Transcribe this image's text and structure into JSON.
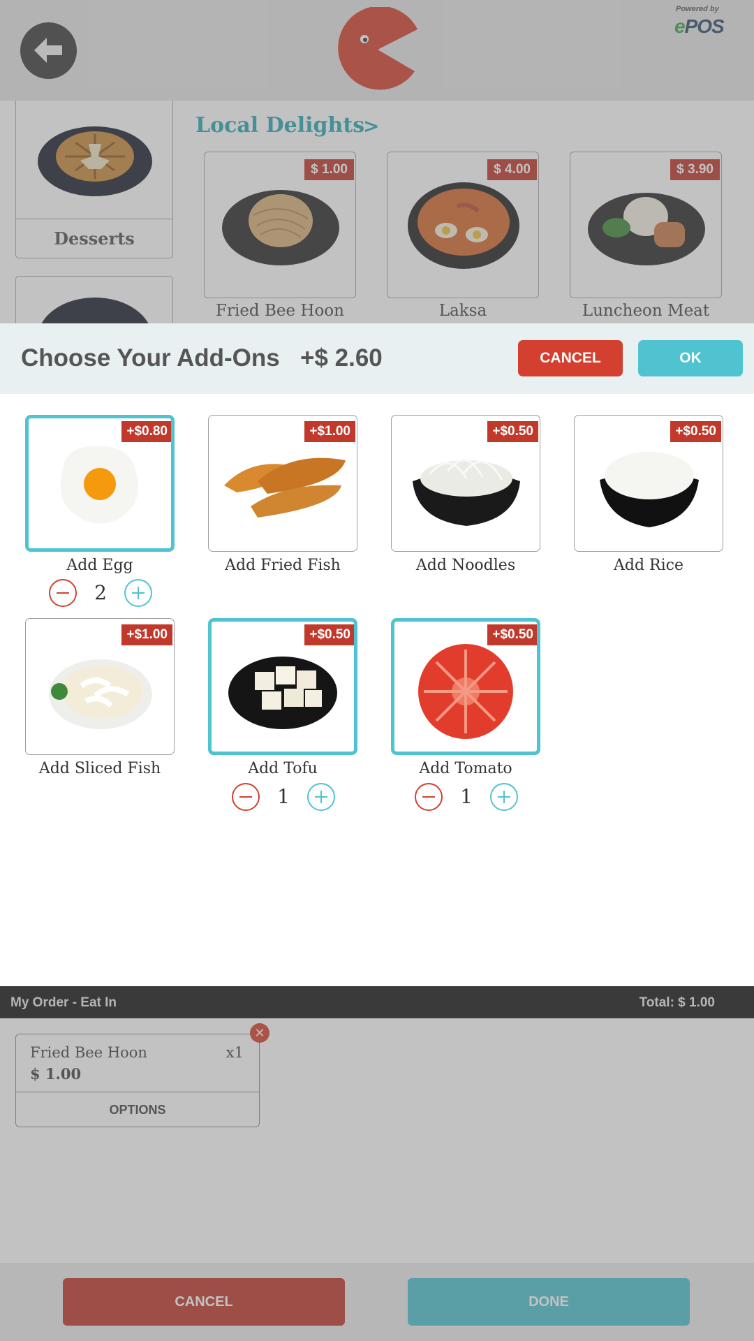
{
  "header": {
    "powered_by": "Powered by",
    "brand_e": "e",
    "brand_pos": "POS"
  },
  "categories": [
    {
      "label": "Desserts"
    }
  ],
  "section": {
    "title": "Local Delights",
    "arrow": ">"
  },
  "products": [
    {
      "name": "Fried Bee Hoon",
      "price": "$ 1.00"
    },
    {
      "name": "Laksa",
      "price": "$ 4.00"
    },
    {
      "name": "Luncheon Meat",
      "price": "$ 3.90"
    }
  ],
  "modal": {
    "title": "Choose Your Add-Ons",
    "total": "+$ 2.60",
    "cancel_label": "CANCEL",
    "ok_label": "OK"
  },
  "addons": [
    {
      "name": "Add Egg",
      "price": "+$0.80",
      "selected": true,
      "qty": "2",
      "icon": "egg-icon"
    },
    {
      "name": "Add Fried Fish",
      "price": "+$1.00",
      "selected": false,
      "icon": "fried-fish-icon"
    },
    {
      "name": "Add Noodles",
      "price": "+$0.50",
      "selected": false,
      "icon": "noodles-icon"
    },
    {
      "name": "Add Rice",
      "price": "+$0.50",
      "selected": false,
      "icon": "rice-icon"
    },
    {
      "name": "Add Sliced Fish",
      "price": "+$1.00",
      "selected": false,
      "icon": "sliced-fish-icon"
    },
    {
      "name": "Add Tofu",
      "price": "+$0.50",
      "selected": true,
      "qty": "1",
      "icon": "tofu-icon"
    },
    {
      "name": "Add Tomato",
      "price": "+$0.50",
      "selected": true,
      "qty": "1",
      "icon": "tomato-icon"
    }
  ],
  "order": {
    "bar_label": "My Order - Eat In",
    "total": "Total: $ 1.00",
    "items": [
      {
        "name": "Fried Bee Hoon",
        "qty": "x1",
        "price": "$ 1.00",
        "options_label": "OPTIONS",
        "remove": "✕"
      }
    ]
  },
  "footer": {
    "cancel_label": "CANCEL",
    "done_label": "DONE"
  },
  "colors": {
    "accent": "#4fc3cf",
    "danger": "#d4402f",
    "brand_red": "#c0392b",
    "section_title": "#2aa7b5"
  }
}
